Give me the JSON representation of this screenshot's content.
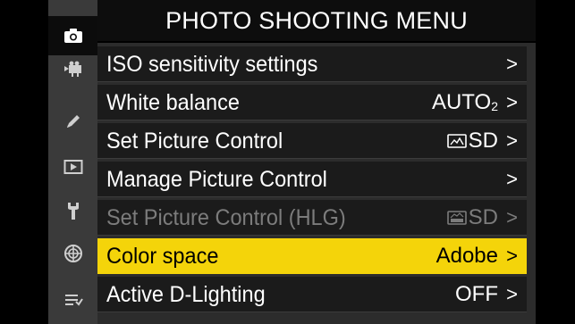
{
  "header": {
    "title": "PHOTO SHOOTING MENU"
  },
  "sidebar": {
    "items": [
      {
        "icon": "camera-icon",
        "active": true
      },
      {
        "icon": "movie-camera-icon",
        "active": false
      },
      {
        "icon": "pencil-icon",
        "active": false
      },
      {
        "icon": "playback-icon",
        "active": false
      },
      {
        "icon": "wrench-icon",
        "active": false
      },
      {
        "icon": "network-icon",
        "active": false
      },
      {
        "icon": "my-menu-icon",
        "active": false
      }
    ]
  },
  "menu": {
    "items": [
      {
        "label": "ISO sensitivity settings",
        "value": "",
        "arrow": ">",
        "state": "normal"
      },
      {
        "label": "White balance",
        "value": "AUTO",
        "value_sub": "2",
        "arrow": ">",
        "state": "normal"
      },
      {
        "label": "Set Picture Control",
        "value": "SD",
        "value_icon": "picture-control-icon",
        "arrow": ">",
        "state": "normal"
      },
      {
        "label": "Manage Picture Control",
        "value": "",
        "arrow": ">",
        "state": "normal"
      },
      {
        "label": "Set Picture Control (HLG)",
        "value": "SD",
        "value_icon": "hlg-picture-control-icon",
        "arrow": ">",
        "state": "disabled"
      },
      {
        "label": "Color space",
        "value": "Adobe",
        "arrow": ">",
        "state": "selected"
      },
      {
        "label": "Active D-Lighting",
        "value": "OFF",
        "arrow": ">",
        "state": "normal"
      }
    ]
  },
  "colors": {
    "highlight": "#f4d40a",
    "row_bg": "#1b1b1b",
    "sidebar_bg": "#3a3a3a",
    "disabled_text": "#7c7c7c"
  }
}
